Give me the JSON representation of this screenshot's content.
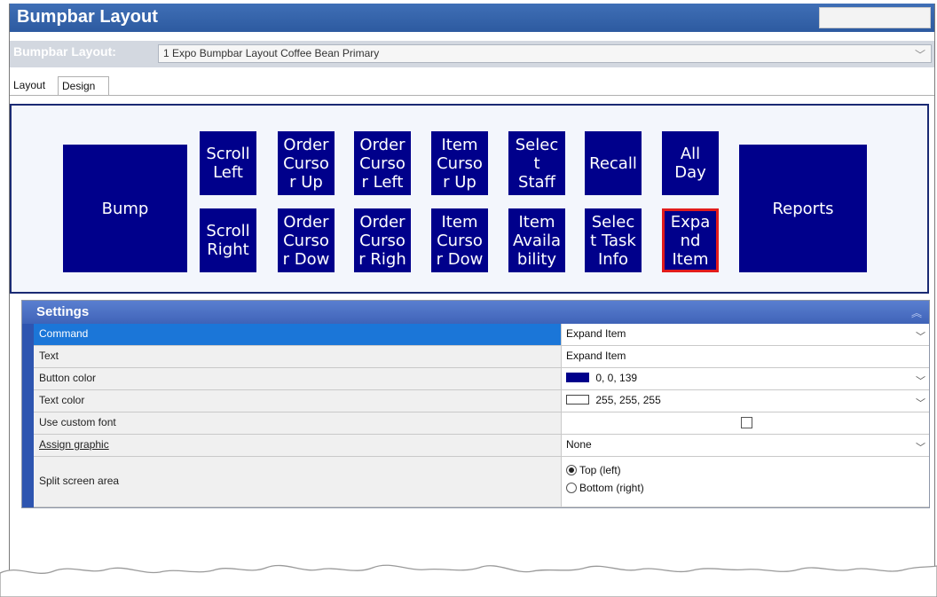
{
  "window": {
    "title": "Bumpbar Layout"
  },
  "layout_selector": {
    "label": "Bumpbar Layout:",
    "value": "1 Expo Bumpbar Layout Coffee Bean Primary"
  },
  "tabs": [
    {
      "label": "Layout"
    },
    {
      "label": "Design"
    }
  ],
  "bumpbar_buttons": {
    "bump": "Bump",
    "scroll_left": "Scroll\nLeft",
    "scroll_right": "Scroll\nRight",
    "order_cursor_up": "Order\nCurso\nr Up",
    "order_cursor_down": "Order\nCurso\nr Dow",
    "order_cursor_left": "Order\nCurso\nr Left",
    "order_cursor_right": "Order\nCurso\nr Righ",
    "item_cursor_up": "Item\nCurso\nr Up",
    "item_cursor_down": "Item\nCurso\nr Dow",
    "select_staff": "Selec\nt\nStaff",
    "item_availability": "Item\nAvaila\nbility",
    "recall": "Recall",
    "select_task_info": "Selec\nt Task\nInfo",
    "all_day": "All\nDay",
    "expand_item": "Expa\nnd\nItem",
    "reports": "Reports"
  },
  "settings": {
    "header": "Settings",
    "rows": {
      "command": {
        "label": "Command",
        "value": "Expand Item"
      },
      "text": {
        "label": "Text",
        "value": "Expand Item"
      },
      "button_color": {
        "label": "Button color",
        "value": "0, 0, 139",
        "swatch": "#00008b"
      },
      "text_color": {
        "label": "Text color",
        "value": "255, 255, 255",
        "swatch": "#ffffff"
      },
      "use_custom_font": {
        "label": "Use custom font",
        "checked": false
      },
      "assign_graphic": {
        "label": "Assign graphic",
        "value": "None"
      },
      "split_screen": {
        "label": "Split screen area",
        "option_top": "Top (left)",
        "option_bottom": "Bottom (right)",
        "selected": "Top (left)"
      }
    }
  },
  "colors": {
    "button_bg": "#00008b",
    "selected_outline": "#e21c1c",
    "title_bar": "#2d5aa0"
  }
}
